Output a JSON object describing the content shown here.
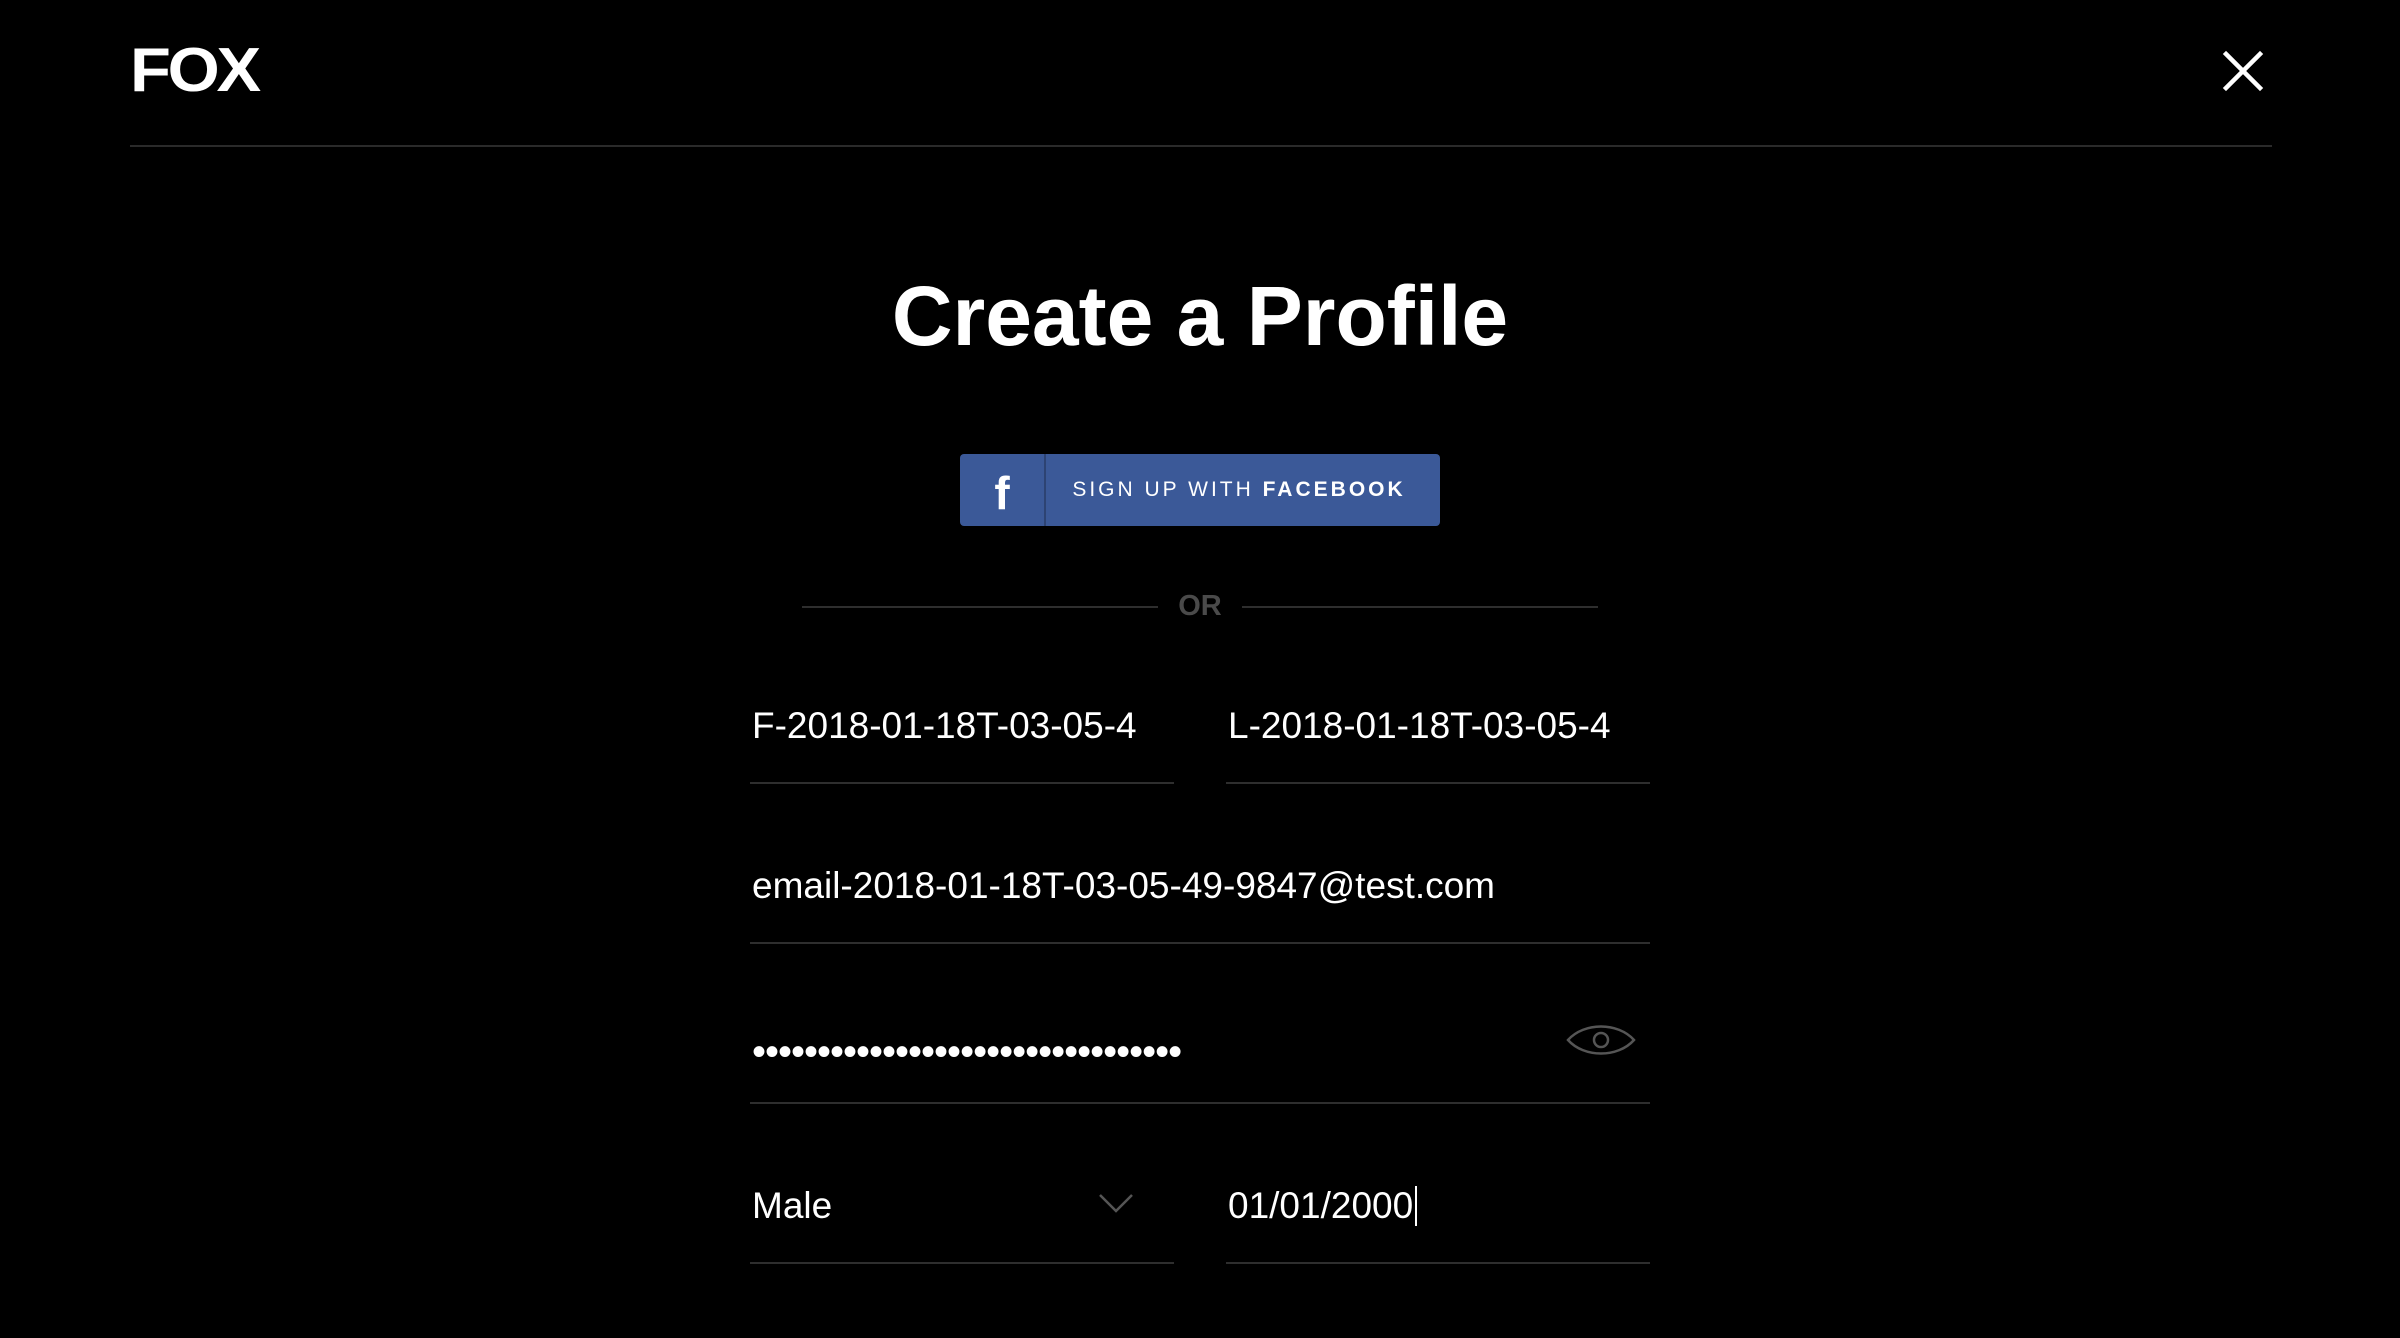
{
  "header": {
    "logo_text": "FOX"
  },
  "title": "Create a Profile",
  "facebook": {
    "label_prefix": "SIGN UP WITH ",
    "label_bold": "FACEBOOK",
    "icon_letter": "f",
    "color": "#3b5998"
  },
  "divider": {
    "text": "OR"
  },
  "form": {
    "first_name": "F-2018-01-18T-03-05-4",
    "last_name": "L-2018-01-18T-03-05-4",
    "email": "email-2018-01-18T-03-05-49-9847@test.com",
    "password_masked": "•••••••••••••••••••••••••••••••••",
    "gender": "Male",
    "dob": "01/01/2000"
  },
  "icons": {
    "close": "close-icon",
    "eye": "eye-icon",
    "chevron": "chevron-down-icon",
    "facebook": "facebook-icon"
  }
}
